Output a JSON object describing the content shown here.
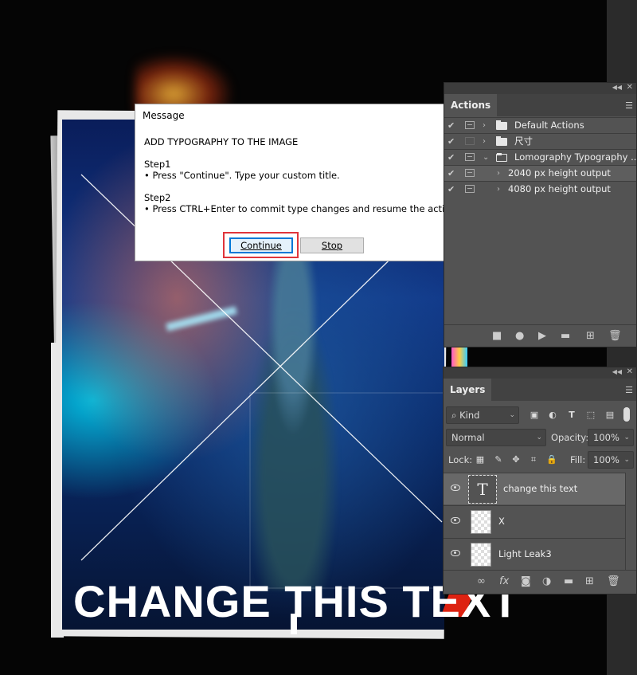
{
  "dialog": {
    "title": "Message",
    "heading": "ADD TYPOGRAPHY TO THE IMAGE",
    "step1_title": "Step1",
    "step1_text": "• Press \"Continue\". Type your custom title.",
    "step2_title": "Step2",
    "step2_text": "• Press CTRL+Enter to commit type changes and resume the action.",
    "continue_label": "Continue",
    "stop_label": "Stop"
  },
  "actions_panel": {
    "tab": "Actions",
    "rows": [
      {
        "label": "Default Actions",
        "enabled": true,
        "toggle": true,
        "expanded": false,
        "kind": "set"
      },
      {
        "label": "尺寸",
        "enabled": true,
        "toggle": false,
        "expanded": false,
        "kind": "set"
      },
      {
        "label": "Lomography Typography ...",
        "enabled": true,
        "toggle": true,
        "expanded": true,
        "kind": "set"
      },
      {
        "label": "2040 px height output",
        "enabled": true,
        "toggle": true,
        "expanded": false,
        "kind": "action",
        "selected": true
      },
      {
        "label": "4080 px height output",
        "enabled": true,
        "toggle": true,
        "expanded": false,
        "kind": "action"
      }
    ],
    "footer_icons": [
      "stop-icon",
      "record-icon",
      "play-icon",
      "folder-icon",
      "new-action-icon",
      "trash-icon"
    ]
  },
  "layers_panel": {
    "tab": "Layers",
    "filter_label": "Kind",
    "blend_mode": "Normal",
    "opacity_label": "Opacity:",
    "opacity_value": "100%",
    "lock_label": "Lock:",
    "fill_label": "Fill:",
    "fill_value": "100%",
    "layers": [
      {
        "name": "change this text",
        "type": "text",
        "selected": true
      },
      {
        "name": "X",
        "type": "pixel"
      },
      {
        "name": "Light Leak3",
        "type": "pixel"
      }
    ],
    "footer_icons": [
      "link-icon",
      "fx-icon",
      "mask-icon",
      "adjustment-icon",
      "group-icon",
      "new-layer-icon",
      "trash-icon"
    ]
  },
  "canvas": {
    "headline": "CHANGE THIS TEXT"
  },
  "colors": {
    "panel_bg": "#535353",
    "dialog_highlight": "#e0353b",
    "button_focus": "#0078d7"
  }
}
